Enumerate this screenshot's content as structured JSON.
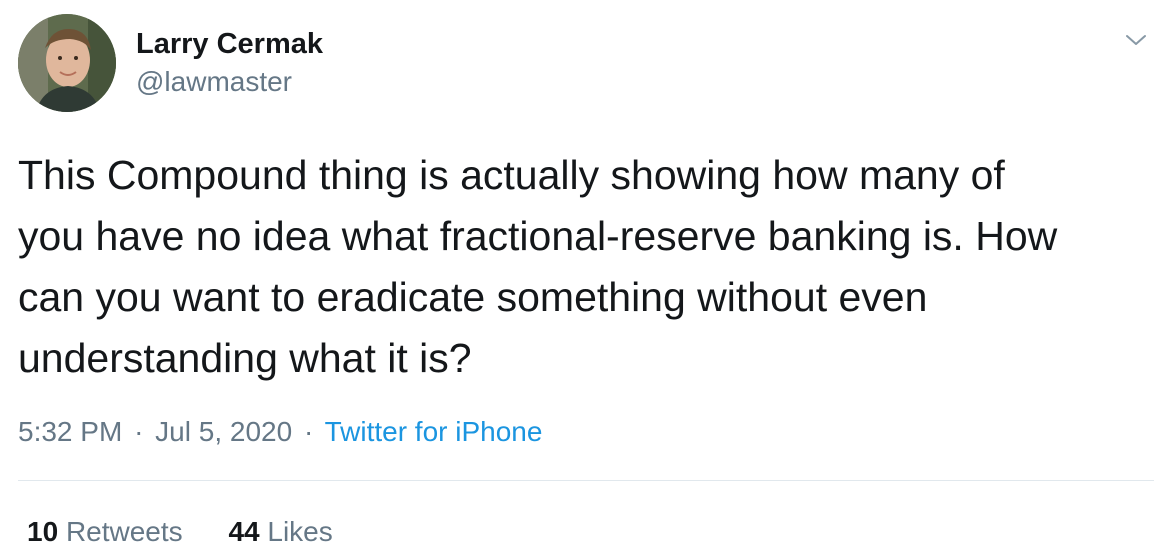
{
  "author": {
    "name": "Larry Cermak",
    "handle": "@lawmaster"
  },
  "tweet": {
    "lines": [
      "This Compound thing is actually showing how many of",
      "you have no idea what fractional-reserve banking is. How",
      "can you want to eradicate something without even",
      "understanding what it is?"
    ]
  },
  "meta": {
    "time": "5:32 PM",
    "separator": "·",
    "date": "Jul 5, 2020",
    "source": "Twitter for iPhone"
  },
  "stats": {
    "retweets_count": "10",
    "retweets_label": "Retweets",
    "likes_count": "44",
    "likes_label": "Likes"
  },
  "colors": {
    "text": "#14171a",
    "secondary": "#657786",
    "link": "#1b95e0",
    "divider": "#e1e8ed"
  },
  "icons": {
    "more": "chevron-down-icon"
  }
}
